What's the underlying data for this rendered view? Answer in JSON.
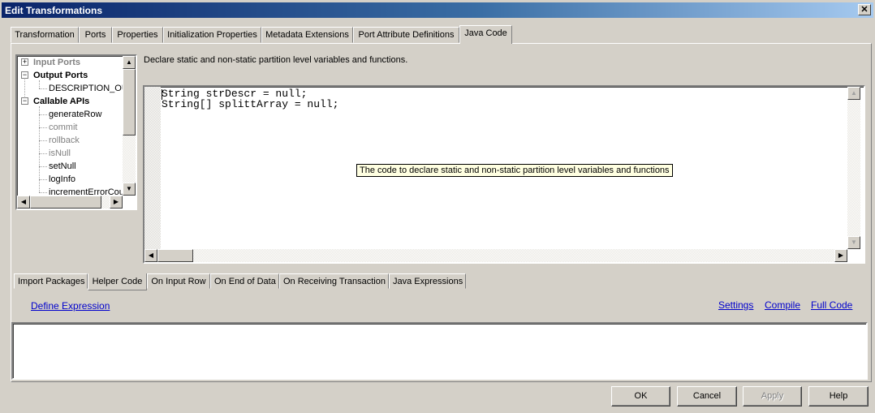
{
  "window": {
    "title": "Edit Transformations",
    "close_symbol": "✕"
  },
  "tabs": [
    {
      "label": "Transformation"
    },
    {
      "label": "Ports"
    },
    {
      "label": "Properties"
    },
    {
      "label": "Initialization Properties"
    },
    {
      "label": "Metadata Extensions"
    },
    {
      "label": "Port Attribute Definitions"
    },
    {
      "label": "Java Code",
      "active": true
    }
  ],
  "tree": {
    "input_ports": "Input Ports",
    "output_ports": "Output Ports",
    "output_child": "DESCRIPTION_OUT",
    "callable_apis": "Callable APIs",
    "apis": [
      "generateRow",
      "commit",
      "rollback",
      "isNull",
      "setNull",
      "logInfo",
      "incrementErrorCount"
    ]
  },
  "editor": {
    "description": "Declare static and non-static partition level variables and functions.",
    "code_lines": [
      "String strDescr = null;",
      "String[] splittArray = null;"
    ],
    "tooltip": "The code to declare static and non-static partition level variables and functions"
  },
  "subtabs": [
    {
      "label": "Import Packages"
    },
    {
      "label": "Helper Code",
      "active": true
    },
    {
      "label": "On Input Row"
    },
    {
      "label": "On End of Data"
    },
    {
      "label": "On Receiving Transaction"
    },
    {
      "label": "Java Expressions"
    }
  ],
  "links": {
    "define_expression": "Define Expression",
    "settings": "Settings",
    "compile": "Compile",
    "full_code": "Full Code"
  },
  "output_box": "",
  "buttons": {
    "ok": "OK",
    "cancel": "Cancel",
    "apply": "Apply",
    "help": "Help"
  }
}
